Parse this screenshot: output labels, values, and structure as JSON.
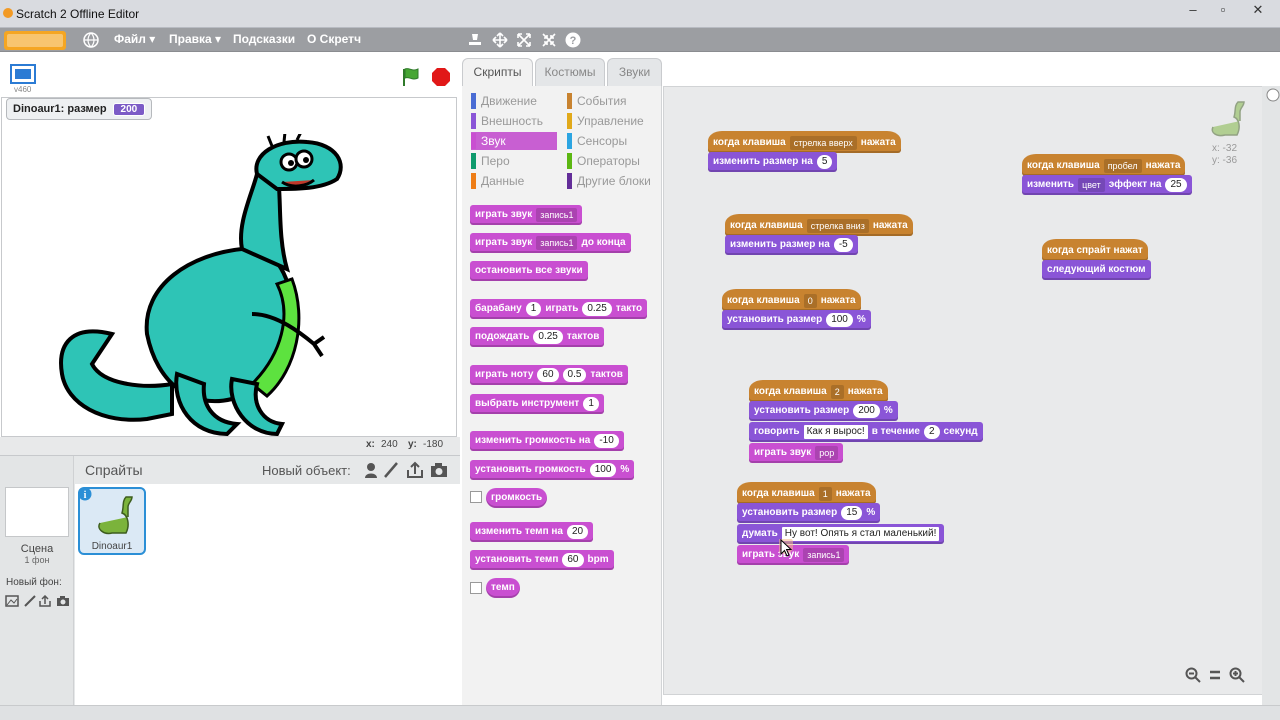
{
  "window": {
    "title": "Scratch 2 Offline Editor",
    "minimize": "‒",
    "maximize": "▫",
    "close": "✕"
  },
  "menu": {
    "items": [
      "Файл ▾",
      "Правка ▾",
      "Подсказки",
      "О Скретч"
    ],
    "toolbar_icons": [
      "stamp-icon",
      "grow-icon",
      "fullscreen-icon",
      "shrink-icon",
      "help-icon"
    ]
  },
  "stage": {
    "version": "v460",
    "monitor_label": "Dinoaur1: размер",
    "monitor_value": "200",
    "coords_x_label": "x:",
    "coords_x": "240",
    "coords_y_label": "y:",
    "coords_y": "-180"
  },
  "sprites": {
    "header": "Спрайты",
    "new_sprite_label": "Новый объект:",
    "stage_name": "Сцена",
    "stage_backdrops": "1 фон",
    "new_backdrop_label": "Новый фон:",
    "items": [
      {
        "name": "Dinoaur1"
      }
    ]
  },
  "tabs": [
    "Скрипты",
    "Костюмы",
    "Звуки"
  ],
  "categories": {
    "left": [
      {
        "label": "Движение",
        "color": "#4a6cd4"
      },
      {
        "label": "Внешность",
        "color": "#8a55d7"
      },
      {
        "label": "Звук",
        "color": "#c94fd1",
        "active": true
      },
      {
        "label": "Перо",
        "color": "#0e9a6c"
      },
      {
        "label": "Данные",
        "color": "#ee7d16"
      }
    ],
    "right": [
      {
        "label": "События",
        "color": "#c88330"
      },
      {
        "label": "Управление",
        "color": "#e1a91a"
      },
      {
        "label": "Сенсоры",
        "color": "#2ca5e2"
      },
      {
        "label": "Операторы",
        "color": "#5cb712"
      },
      {
        "label": "Другие блоки",
        "color": "#632d99"
      }
    ]
  },
  "palette": {
    "play_sound": "играть звук",
    "sound1": "запись1",
    "play_sound_until": "играть звук",
    "until_done": "до конца",
    "stop_all": "остановить все звуки",
    "drum": "барабану",
    "drum_val": "1",
    "drum_play": "играть",
    "drum_beats": "0.25",
    "drum_unit": "такто",
    "rest": "подождать",
    "rest_beats": "0.25",
    "rest_unit": "тактов",
    "note": "играть ноту",
    "note_val": "60",
    "note_beats": "0.5",
    "note_unit": "тактов",
    "instrument": "выбрать инструмент",
    "instrument_val": "1",
    "change_volume": "изменить громкость на",
    "change_volume_val": "-10",
    "set_volume": "установить громкость",
    "set_volume_val": "100",
    "set_volume_unit": "%",
    "volume": "громкость",
    "change_tempo": "изменить темп на",
    "change_tempo_val": "20",
    "set_tempo": "установить темп",
    "set_tempo_val": "60",
    "set_tempo_unit": "bpm",
    "tempo": "темп"
  },
  "scripts": {
    "sprite_x": "x: -32",
    "sprite_y": "y: -36",
    "s1": {
      "when": "когда клавиша",
      "key": "стрелка вверх",
      "pressed": "нажата",
      "b1": "изменить размер на",
      "b1v": "5"
    },
    "s2": {
      "when": "когда клавиша",
      "key": "стрелка вниз",
      "pressed": "нажата",
      "b1": "изменить размер на",
      "b1v": "-5"
    },
    "s3": {
      "when": "когда клавиша",
      "key": "0",
      "pressed": "нажата",
      "b1": "установить размер",
      "b1v": "100",
      "b1u": "%"
    },
    "s4": {
      "when": "когда клавиша",
      "key": "2",
      "pressed": "нажата",
      "b1": "установить размер",
      "b1v": "200",
      "b1u": "%",
      "b2": "говорить",
      "b2v": "Как я вырос!",
      "b2m": "в течение",
      "b2n": "2",
      "b2u": "секунд",
      "b3": "играть звук",
      "b3v": "pop"
    },
    "s5": {
      "when": "когда клавиша",
      "key": "1",
      "pressed": "нажата",
      "b1": "установить размер",
      "b1v": "15",
      "b1u": "%",
      "b2": "думать",
      "b2v": "Ну вот! Опять я стал маленький!",
      "b3": "играть звук",
      "b3v": "запись1"
    },
    "s6": {
      "when": "когда клавиша",
      "key": "пробел",
      "pressed": "нажата",
      "b1": "изменить",
      "b1d": "цвет",
      "b1m": "эффект на",
      "b1v": "25"
    },
    "s7": {
      "when": "когда спрайт нажат",
      "b1": "следующий костюм"
    }
  }
}
